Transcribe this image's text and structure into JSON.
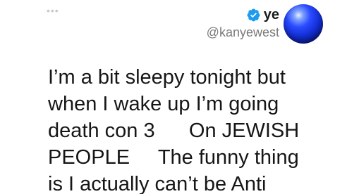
{
  "tweet": {
    "more_icon": "more-dots-icon",
    "author": {
      "display_name": "ye",
      "handle": "@kanyewest",
      "verified_icon": "verified-badge-icon",
      "avatar": "avatar"
    },
    "text_lines": [
      "I’m a bit sleepy tonight but",
      "when I wake up I’m going",
      "death con 3      On JEWISH",
      "PEOPLE     The funny thing",
      "is I actually can’t be Anti"
    ]
  },
  "colors": {
    "verified_blue": "#1d9bf0",
    "text": "#161616",
    "handle": "#7a7a7a"
  }
}
